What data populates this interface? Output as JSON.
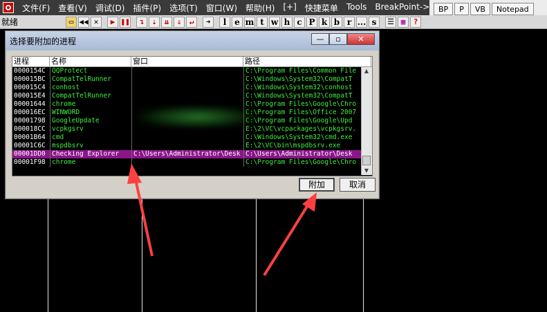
{
  "menubar": {
    "items": [
      "文件(F)",
      "查看(V)",
      "调试(D)",
      "插件(P)",
      "选项(T)",
      "窗口(W)",
      "帮助(H)",
      "[+]",
      "快捷菜单",
      "Tools",
      "BreakPoint->"
    ],
    "right_tabs": [
      "BP",
      "P",
      "VB",
      "Notepad"
    ]
  },
  "toolbar": {
    "status": "就绪",
    "letters": [
      "l",
      "e",
      "m",
      "t",
      "w",
      "h",
      "c",
      "P",
      "k",
      "b",
      "r",
      "...",
      "s"
    ]
  },
  "dialog": {
    "title": "选择要附加的进程",
    "columns": [
      "进程",
      "名称",
      "窗口",
      "路径"
    ],
    "rows": [
      {
        "pid": "0000154C",
        "name": "QQProtect",
        "window": "",
        "path": "C:\\Program Files\\Common File"
      },
      {
        "pid": "000015BC",
        "name": "CompatTelRunner",
        "window": "",
        "path": "C:\\Windows\\System32\\CompatT"
      },
      {
        "pid": "000015C4",
        "name": "conhost",
        "window": "",
        "path": "C:\\Windows\\System32\\conhost"
      },
      {
        "pid": "000015E4",
        "name": "CompatTelRunner",
        "window": "",
        "path": "C:\\Windows\\System32\\CompatT"
      },
      {
        "pid": "00001644",
        "name": "chrome",
        "window": "",
        "path": "C:\\Program Files\\Google\\Chro"
      },
      {
        "pid": "000016EC",
        "name": "WINWORD",
        "window": "",
        "path": "C:\\Program Files\\Office 2007"
      },
      {
        "pid": "00001798",
        "name": "GoogleUpdate",
        "window": "",
        "path": "C:\\Program Files\\Google\\Upd"
      },
      {
        "pid": "000018CC",
        "name": "vcpkgsrv",
        "window": "",
        "path": "E:\\2\\VC\\vcpackages\\vcpkgsrv."
      },
      {
        "pid": "00001B64",
        "name": "cmd",
        "window": "",
        "path": "C:\\Windows\\System32\\cmd.exe"
      },
      {
        "pid": "00001C6C",
        "name": "mspdbsrv",
        "window": "",
        "path": "E:\\2\\VC\\bin\\mspdbsrv.exe"
      },
      {
        "pid": "00001DD0",
        "name": "Checking Explorer",
        "window": "C:\\Users\\Administrator\\Desk",
        "path": "C:\\Users\\Administrator\\Desk",
        "selected": true
      },
      {
        "pid": "00001F98",
        "name": "chrome",
        "window": "",
        "path": "C:\\Program Files\\Google\\Chro"
      }
    ],
    "attach_label": "附加",
    "cancel_label": "取消"
  },
  "colors": {
    "selected_row": "#8a168a",
    "text_green": "#3cf03c",
    "arrow_red": "#ff4040"
  }
}
